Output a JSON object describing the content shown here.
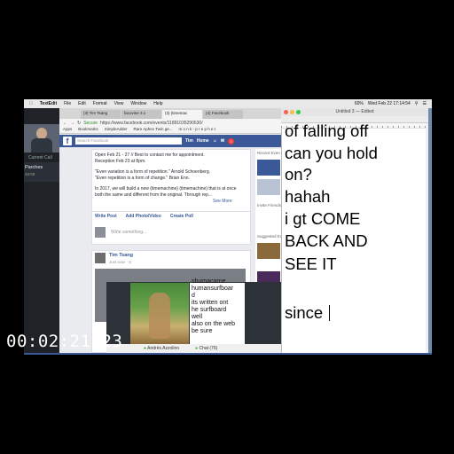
{
  "menubar": {
    "app_name": "TextEdit",
    "items": [
      "File",
      "Edit",
      "Format",
      "View",
      "Window",
      "Help"
    ],
    "clock": "Wed Feb 22  17:14:54",
    "battery": "60%"
  },
  "call_panel": {
    "label": "Current Call",
    "contact_name": "Parches",
    "duration": "49:09"
  },
  "browser": {
    "tabs": [
      {
        "label": "(3) Tim Tsang"
      },
      {
        "label": "facovine 3.1"
      },
      {
        "label": "(3) (timemac"
      },
      {
        "label": "(4) Facebook"
      }
    ],
    "secure_label": "Secure",
    "url": "https://www.facebook.com/events/11891035290630/",
    "bookmarks": [
      "Apps",
      "Bookmarks",
      "SimpleAdder",
      "Rare Aphex Twin ge...",
      "m o n k - p r e p h e t"
    ]
  },
  "facebook": {
    "search_placeholder": "Search Facebook",
    "profile_name": "Tim",
    "home_label": "Home",
    "notification_count": "3",
    "event_lines": [
      "Open Feb 21 - 27 // Best to contact me for appointment.",
      "Reception Feb 23 at 8pm.",
      "\"Even variation is a form of repetition.\" Arnold Schoenberg.",
      "\"Even repetition is a form of change.\" Brian Eno.",
      "In 2017, we will build a new (timemachine) (timemachine) that is at once",
      "both the same and different from the original. Through rep..."
    ],
    "see_more": "See More",
    "composer_actions": [
      "Write Post",
      "Add Photo/Video",
      "Create Poll"
    ],
    "composer_placeholder": "Write something...",
    "post_author": "Tim Tsang",
    "post_time": "Just now · ⊙",
    "right_column": [
      "Recent Even",
      "Invite Friends",
      "Suggested Ev"
    ],
    "nested_text": [
      "shumacarne",
      "humansurfboar",
      "d",
      "its written ont",
      "he surfboard",
      "well",
      "also on the web",
      "be sure"
    ],
    "nested_bar": [
      "Andrés Azzolino",
      "Chat (76)"
    ]
  },
  "textedit": {
    "title": "Untitled 3 — Edited",
    "lines": [
      "of falling off",
      "can you hold",
      "on?",
      "hahah",
      "i gt COME",
      "BACK AND",
      "SEE IT",
      "",
      "since"
    ]
  },
  "overlay": {
    "timecode": "00:02:21;23"
  },
  "colors": {
    "facebook_blue": "#3b5998",
    "link_blue": "#365899",
    "end_call_red": "#e0302a"
  }
}
